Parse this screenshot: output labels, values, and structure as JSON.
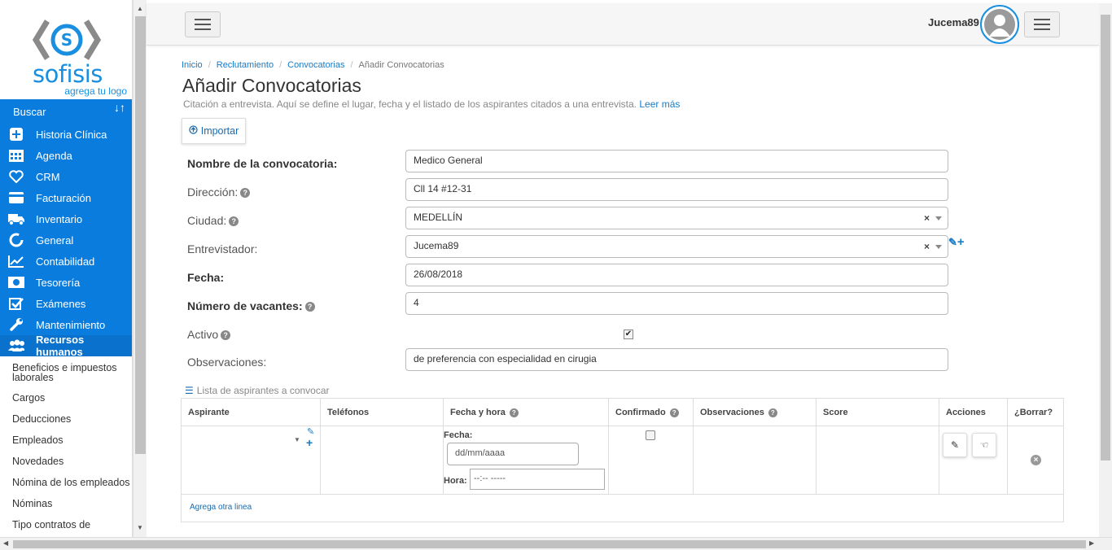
{
  "sidebar": {
    "logo_text": "sofisis",
    "logo_tag": "agrega tu logo",
    "search_label": "Buscar",
    "search_sort_icon": "↓↑",
    "items": [
      {
        "label": "Historia Clínica",
        "icon": "plus-square-icon"
      },
      {
        "label": "Agenda",
        "icon": "calendar-icon"
      },
      {
        "label": "CRM",
        "icon": "heart-icon"
      },
      {
        "label": "Facturación",
        "icon": "credit-card-icon"
      },
      {
        "label": "Inventario",
        "icon": "truck-icon"
      },
      {
        "label": "General",
        "icon": "circle-notch-icon"
      },
      {
        "label": "Contabilidad",
        "icon": "line-chart-icon"
      },
      {
        "label": "Tesorería",
        "icon": "money-icon"
      },
      {
        "label": "Exámenes",
        "icon": "check-square-icon"
      },
      {
        "label": "Mantenimiento",
        "icon": "wrench-icon"
      },
      {
        "label": "Recursos humanos",
        "icon": "users-icon"
      }
    ],
    "subitems": [
      "Beneficios e impuestos laborales",
      "Cargos",
      "Deducciones",
      "Empleados",
      "Novedades",
      "Nómina de los empleados",
      "Nóminas",
      "Tipo contratos de"
    ]
  },
  "header": {
    "username": "Jucema89"
  },
  "breadcrumb": [
    "Inicio",
    "Reclutamiento",
    "Convocatorias",
    "Añadir Convocatorias"
  ],
  "page": {
    "title": "Añadir Convocatorias",
    "description": "Citación a entrevista. Aquí se define el lugar, fecha y el listado de los aspirantes citados a una entrevista.",
    "more_link": "Leer más",
    "import_label": "Importar"
  },
  "form": {
    "nombre": {
      "label": "Nombre de la convocatoria:",
      "value": "Medico General"
    },
    "direccion": {
      "label": "Dirección:",
      "value": "Cll 14 #12-31"
    },
    "ciudad": {
      "label": "Ciudad:",
      "value": "MEDELLÍN"
    },
    "entrevistador": {
      "label": "Entrevistador:",
      "value": "Jucema89"
    },
    "fecha": {
      "label": "Fecha:",
      "value": "26/08/2018"
    },
    "vacantes": {
      "label": "Número de vacantes:",
      "value": "4"
    },
    "activo": {
      "label": "Activo",
      "checked": true
    },
    "observaciones": {
      "label": "Observaciones:",
      "value": "de preferencia con especialidad en cirugia"
    }
  },
  "list": {
    "title": "Lista de aspirantes a convocar",
    "columns": [
      "Aspirante",
      "Teléfonos",
      "Fecha y hora",
      "Confirmado",
      "Observaciones",
      "Score",
      "Acciones",
      "¿Borrar?"
    ],
    "row": {
      "fecha_label": "Fecha:",
      "fecha_placeholder": "dd/mm/aaaa",
      "hora_label": "Hora:",
      "hora_placeholder": "--:-- -----"
    },
    "add_line": "Agrega otra linea"
  }
}
